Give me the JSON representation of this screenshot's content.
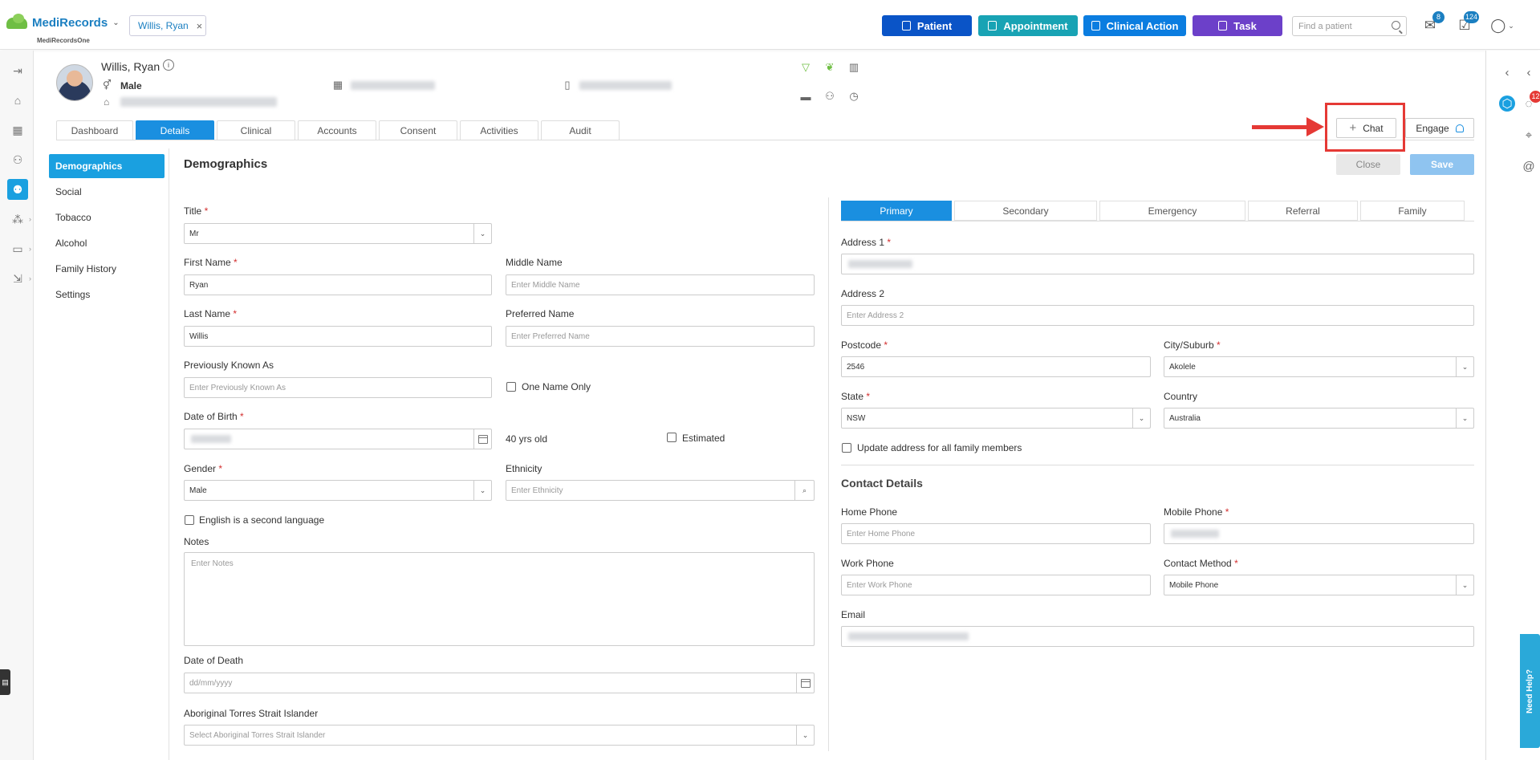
{
  "header": {
    "brand": "MediRecords",
    "brand_sub": "MediRecordsOne",
    "open_patient": "Willis, Ryan",
    "buttons": {
      "patient": "Patient",
      "appointment": "Appointment",
      "clinical_action": "Clinical Action",
      "task": "Task"
    },
    "search_placeholder": "Find a patient",
    "mail_count": "8",
    "task_count": "124",
    "colors": {
      "patient": "#0a54c7",
      "appointment": "#18a3b4",
      "clinical_action": "#0b7de0",
      "task": "#6c40c9"
    }
  },
  "patient": {
    "name": "Willis, Ryan",
    "gender": "Male"
  },
  "tabs": [
    "Dashboard",
    "Details",
    "Clinical",
    "Accounts",
    "Consent",
    "Activities",
    "Audit"
  ],
  "active_tab": "Details",
  "actions": {
    "chat": "Chat",
    "engage": "Engage",
    "close": "Close",
    "save": "Save"
  },
  "sidebar": {
    "items": [
      "Demographics",
      "Social",
      "Tobacco",
      "Alcohol",
      "Family History",
      "Settings"
    ],
    "active": "Demographics"
  },
  "demographics": {
    "title": "Demographics",
    "title_label": "Title",
    "title_value": "Mr",
    "first_name_label": "First Name",
    "first_name_value": "Ryan",
    "middle_name_label": "Middle Name",
    "middle_name_placeholder": "Enter Middle Name",
    "last_name_label": "Last Name",
    "last_name_value": "Willis",
    "preferred_name_label": "Preferred Name",
    "preferred_name_placeholder": "Enter Preferred Name",
    "prev_known_label": "Previously Known As",
    "prev_known_placeholder": "Enter Previously Known As",
    "one_name_only": "One Name Only",
    "dob_label": "Date of Birth",
    "age": "40 yrs old",
    "estimated": "Estimated",
    "gender_label": "Gender",
    "gender_value": "Male",
    "ethnicity_label": "Ethnicity",
    "ethnicity_placeholder": "Enter Ethnicity",
    "esl": "English is a second language",
    "notes_label": "Notes",
    "notes_placeholder": "Enter Notes",
    "dod_label": "Date of Death",
    "dod_placeholder": "dd/mm/yyyy",
    "atsi_label": "Aboriginal Torres Strait Islander",
    "atsi_placeholder": "Select Aboriginal Torres Strait Islander"
  },
  "address": {
    "tabs": [
      "Primary",
      "Secondary",
      "Emergency",
      "Referral",
      "Family"
    ],
    "active": "Primary",
    "address1_label": "Address 1",
    "address2_label": "Address 2",
    "address2_placeholder": "Enter Address 2",
    "postcode_label": "Postcode",
    "postcode_value": "2546",
    "city_label": "City/Suburb",
    "city_value": "Akolele",
    "state_label": "State",
    "state_value": "NSW",
    "country_label": "Country",
    "country_value": "Australia",
    "update_family": "Update address for all family members"
  },
  "contact": {
    "title": "Contact Details",
    "home_label": "Home Phone",
    "home_placeholder": "Enter Home Phone",
    "mobile_label": "Mobile Phone",
    "work_label": "Work Phone",
    "work_placeholder": "Enter Work Phone",
    "method_label": "Contact Method",
    "method_value": "Mobile Phone",
    "email_label": "Email"
  },
  "help": {
    "label": "Need Help?",
    "notif_count": "12"
  }
}
